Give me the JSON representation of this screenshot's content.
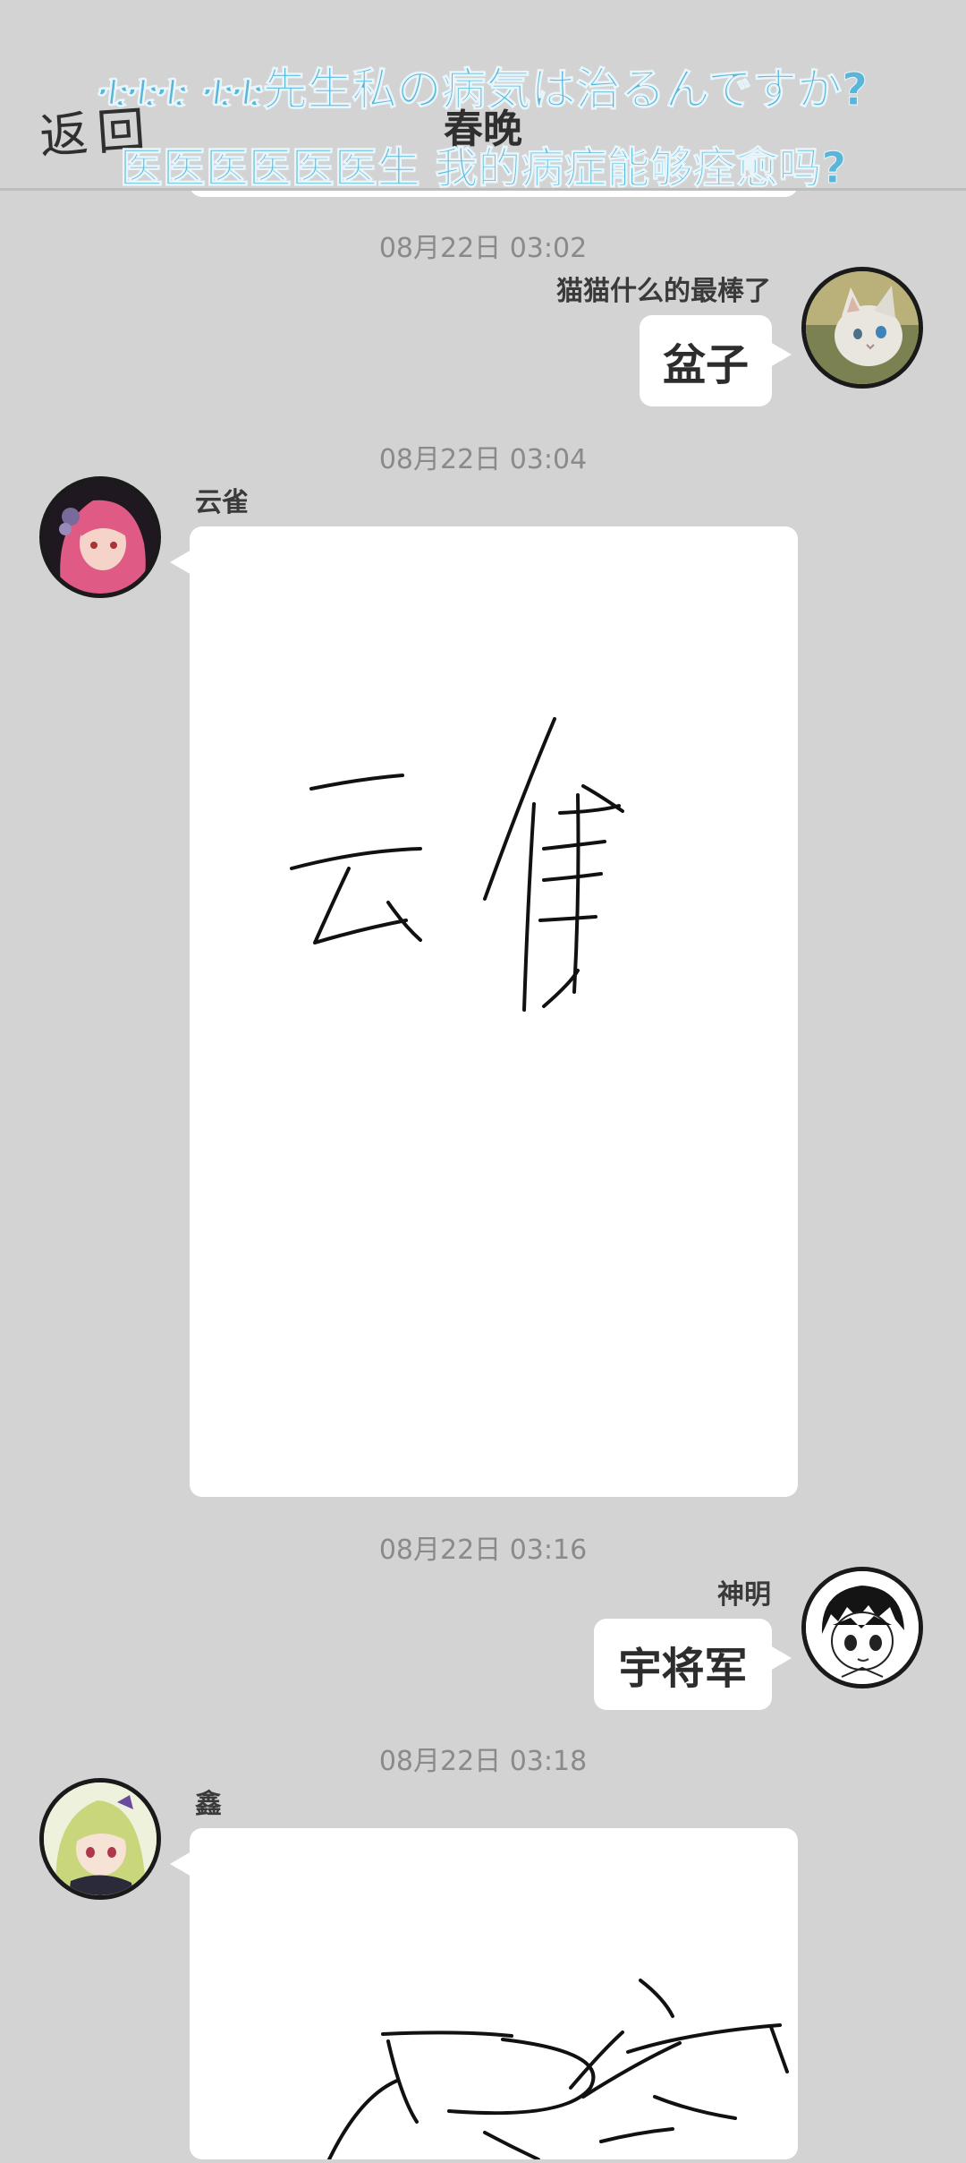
{
  "header": {
    "back_label": "返回",
    "title": "春晚",
    "banner_line_1": "ቲቲቲ ቲቲ先生私の病気は治るんですか?",
    "banner_line_2": "医医医医医医生 我的病症能够痊愈吗?"
  },
  "messages": [
    {
      "timestamp": "08月22日  03:02",
      "sender": "猫猫什么的最棒了",
      "text": "盆子",
      "side": "right",
      "avatar": "cat-avatar"
    },
    {
      "timestamp": "08月22日  03:04",
      "sender": "云雀",
      "side": "left",
      "avatar": "pink-hair-girl-avatar",
      "drawing": "handwritten-yunque-drawing"
    },
    {
      "timestamp": "08月22日  03:16",
      "sender": "神明",
      "text": "宇将军",
      "side": "right",
      "avatar": "manga-boy-avatar"
    },
    {
      "timestamp": "08月22日  03:18",
      "sender": "鑫",
      "side": "left",
      "avatar": "green-hair-girl-avatar",
      "drawing": "handwritten-partial-drawing"
    }
  ],
  "colors": {
    "background": "#d3d3d3",
    "bubble": "#ffffff",
    "banner_text": "#59b6d9",
    "timestamp": "#8a8a8a"
  }
}
